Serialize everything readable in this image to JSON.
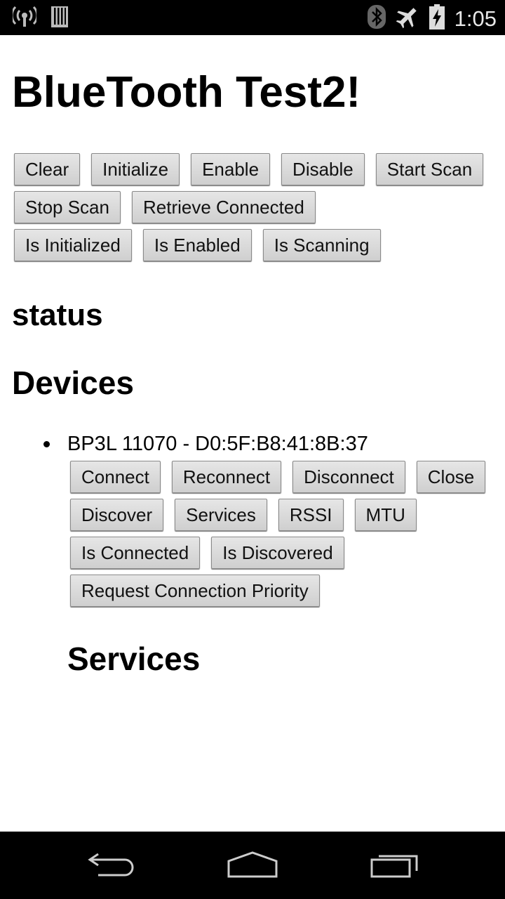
{
  "status_bar": {
    "time": "1:05",
    "icons": [
      "wifi-hotspot-icon",
      "sd-card-icon",
      "bluetooth-icon",
      "airplane-mode-icon",
      "battery-charging-icon"
    ]
  },
  "app": {
    "title": "BlueTooth Test2!",
    "buttons_row1": [
      "Clear",
      "Initialize",
      "Enable",
      "Disable",
      "Start Scan"
    ],
    "buttons_row2": [
      "Stop Scan",
      "Retrieve Connected"
    ],
    "buttons_row3": [
      "Is Initialized",
      "Is Enabled",
      "Is Scanning"
    ],
    "status_label": "status",
    "devices_label": "Devices",
    "device": {
      "name": "BP3L 11070 - D0:5F:B8:41:8B:37",
      "actions_row1": [
        "Connect",
        "Reconnect",
        "Disconnect",
        "Close"
      ],
      "actions_row2": [
        "Discover",
        "Services",
        "RSSI",
        "MTU"
      ],
      "actions_row3": [
        "Is Connected",
        "Is Discovered"
      ],
      "actions_row4": [
        "Request Connection Priority"
      ]
    },
    "services_label": "Services"
  },
  "nav_bar": {
    "icons": [
      "back-icon",
      "home-icon",
      "recent-apps-icon"
    ]
  }
}
